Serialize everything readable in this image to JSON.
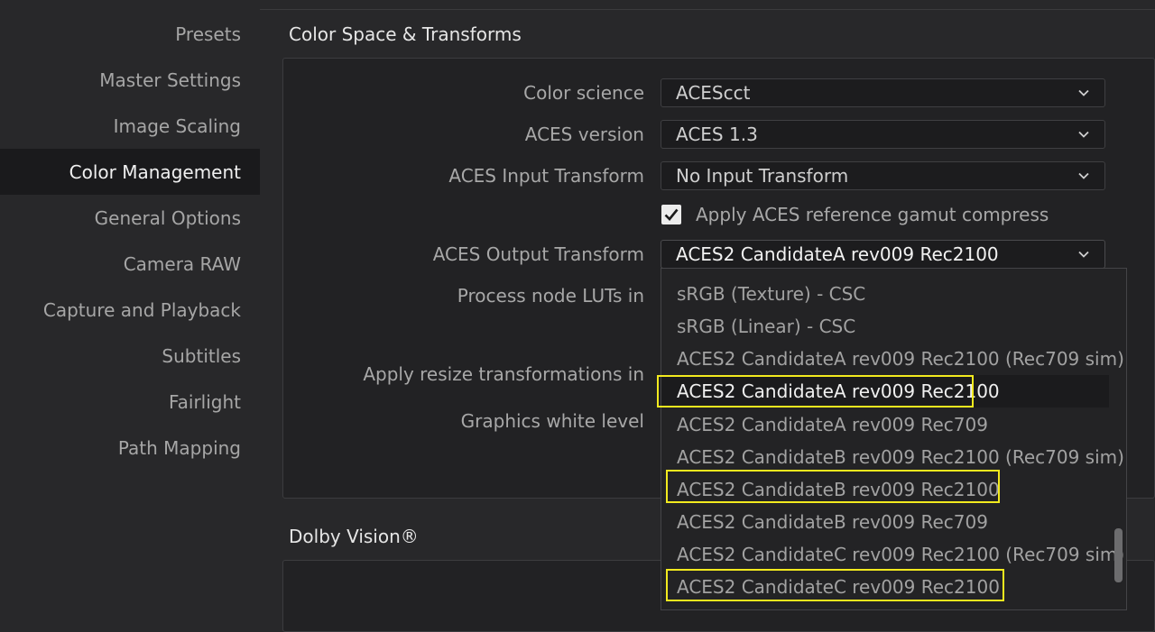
{
  "sidebar": {
    "items": [
      {
        "label": "Presets",
        "active": false
      },
      {
        "label": "Master Settings",
        "active": false
      },
      {
        "label": "Image Scaling",
        "active": false
      },
      {
        "label": "Color Management",
        "active": true
      },
      {
        "label": "General Options",
        "active": false
      },
      {
        "label": "Camera RAW",
        "active": false
      },
      {
        "label": "Capture and Playback",
        "active": false
      },
      {
        "label": "Subtitles",
        "active": false
      },
      {
        "label": "Fairlight",
        "active": false
      },
      {
        "label": "Path Mapping",
        "active": false
      }
    ]
  },
  "color_space": {
    "title": "Color Space & Transforms",
    "color_science": {
      "label": "Color science",
      "value": "ACEScct"
    },
    "aces_version": {
      "label": "ACES version",
      "value": "ACES 1.3"
    },
    "input_transform": {
      "label": "ACES Input Transform",
      "value": "No Input Transform"
    },
    "gamut_compress": {
      "label": "Apply ACES reference gamut compress",
      "checked": true
    },
    "output_transform": {
      "label": "ACES Output Transform",
      "value": "ACES2 CandidateA rev009 Rec2100"
    },
    "process_luts_label": "Process node LUTs in",
    "resize_label": "Apply resize transformations in",
    "graphics_white_label": "Graphics white level"
  },
  "dolby": {
    "title": "Dolby Vision®"
  },
  "dropdown": {
    "options": [
      "sRGB (Texture) - CSC",
      "sRGB (Linear) - CSC",
      "ACES2 CandidateA rev009 Rec2100 (Rec709 sim)",
      "ACES2 CandidateA rev009 Rec2100",
      "ACES2 CandidateA rev009 Rec709",
      "ACES2 CandidateB rev009 Rec2100 (Rec709 sim)",
      "ACES2 CandidateB rev009 Rec2100",
      "ACES2 CandidateB rev009 Rec709",
      "ACES2 CandidateC rev009 Rec2100 (Rec709 sim)",
      "ACES2 CandidateC rev009 Rec2100"
    ],
    "selected_index": 3,
    "highlighted_indices": [
      3,
      6,
      9
    ],
    "highlight_color": "#f2ea1e"
  },
  "icons": {
    "dropdown": "chevron-down-icon",
    "check": "check-icon"
  }
}
